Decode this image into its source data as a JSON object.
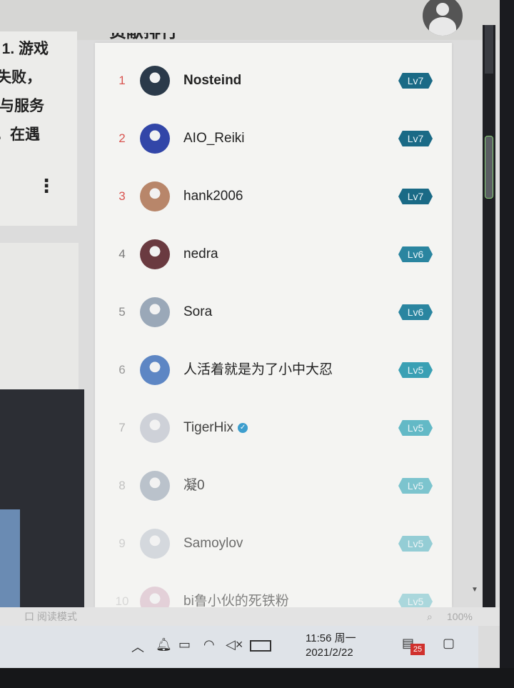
{
  "left_article": {
    "lines": [
      "1. 游戏",
      "失败，",
      "与服务",
      "。在遇"
    ],
    "more": "⋮"
  },
  "leaderboard": {
    "title": "贡献排行",
    "rows": [
      {
        "rank": "1",
        "name": "Nosteind",
        "level": "Lv7",
        "rank_color": "#d9534f",
        "name_weight": "bold",
        "avatar_color": "#2b3a4a",
        "level_color": "#1a6a86"
      },
      {
        "rank": "2",
        "name": "AIO_Reiki",
        "level": "Lv7",
        "rank_color": "#d9534f",
        "name_weight": "normal",
        "avatar_color": "#3246a8",
        "level_color": "#1a6a86"
      },
      {
        "rank": "3",
        "name": "hank2006",
        "level": "Lv7",
        "rank_color": "#d9534f",
        "name_weight": "normal",
        "avatar_color": "#b8866a",
        "level_color": "#1a6a86"
      },
      {
        "rank": "4",
        "name": "nedra",
        "level": "Lv6",
        "rank_color": "#777777",
        "name_weight": "normal",
        "avatar_color": "#6a3a40",
        "level_color": "#2a85a0"
      },
      {
        "rank": "5",
        "name": "Sora",
        "level": "Lv6",
        "rank_color": "#888888",
        "name_weight": "normal",
        "avatar_color": "#9aa8b8",
        "level_color": "#2a85a0"
      },
      {
        "rank": "6",
        "name": "人活着就是为了小中大忍",
        "level": "Lv5",
        "rank_color": "#999999",
        "name_weight": "normal",
        "avatar_color": "#5d86c4",
        "level_color": "#3aa0b4"
      },
      {
        "rank": "7",
        "name": "TigerHix",
        "level": "Lv5",
        "rank_color": "#aaaaaa",
        "name_weight": "normal",
        "avatar_color": "#c8ccd4",
        "level_color": "#4aafbf",
        "verified": true
      },
      {
        "rank": "8",
        "name": "凝0",
        "level": "Lv5",
        "rank_color": "#b0b0b0",
        "name_weight": "normal",
        "avatar_color": "#a7b2bf",
        "level_color": "#55b4c2"
      },
      {
        "rank": "9",
        "name": "Samoylov",
        "level": "Lv5",
        "rank_color": "#bbbbbb",
        "name_weight": "normal",
        "avatar_color": "#c4cad2",
        "level_color": "#62b9c6"
      },
      {
        "rank": "10",
        "name": "bi鲁小伙的死铁粉",
        "level": "Lv5",
        "rank_color": "#c0c0c0",
        "name_weight": "normal",
        "avatar_color": "#d6b4c4",
        "level_color": "#6fc0cb"
      }
    ]
  },
  "statusbar": {
    "left": "口 阅读模式",
    "zoom": "100%"
  },
  "taskbar": {
    "time": "11:56 周一",
    "date": "2021/2/22",
    "notification_count": "25"
  }
}
